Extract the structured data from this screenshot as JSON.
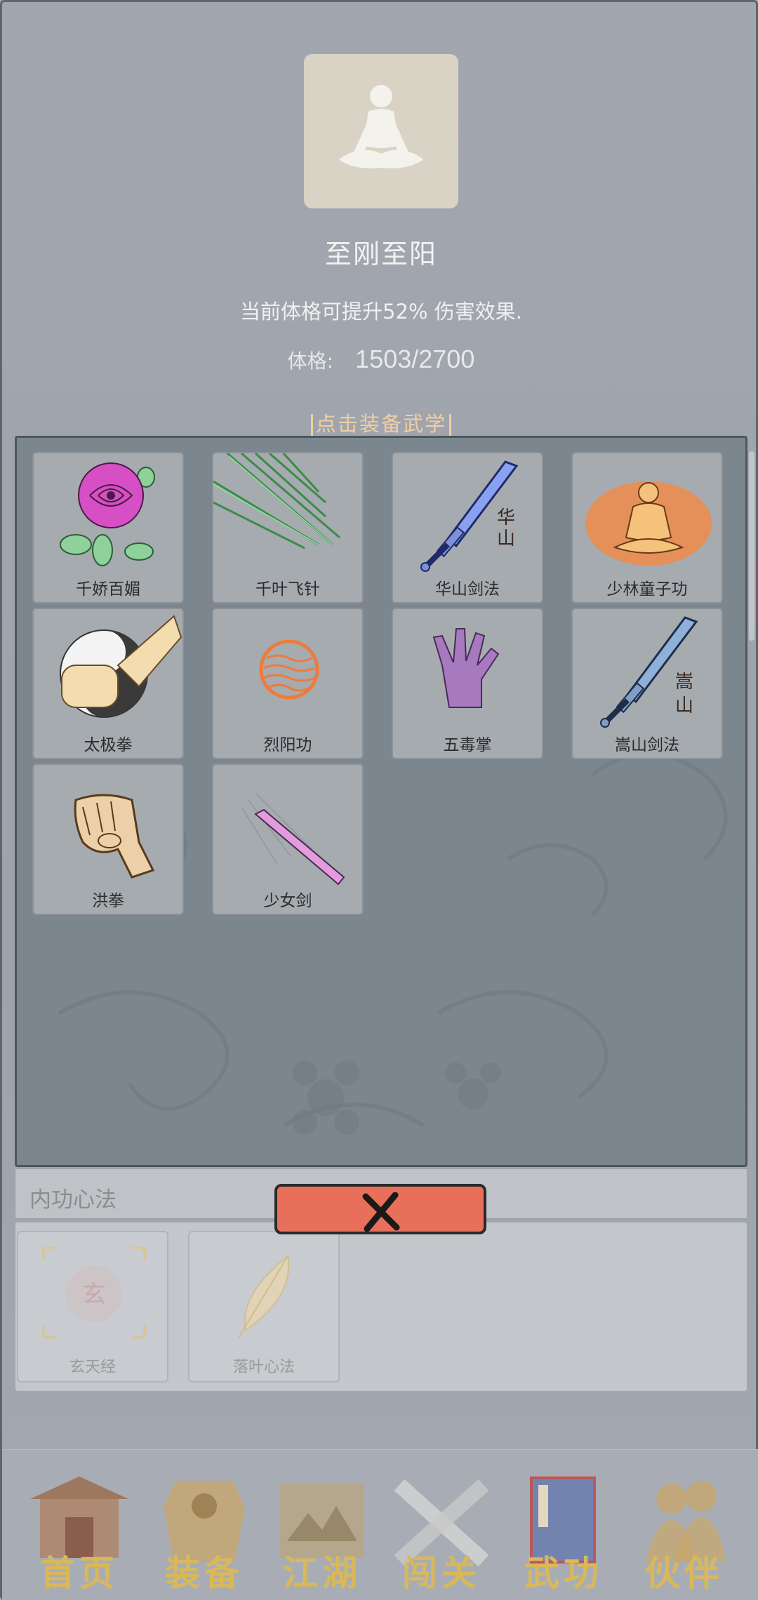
{
  "current_art": {
    "title": "至刚至阳",
    "description": "当前体格可提升52% 伤害效果.",
    "stat_label": "体格:",
    "stat_value": "1503/2700"
  },
  "hint": "点击装备武学",
  "martial_arts": [
    {
      "name": "千娇百媚",
      "icon": "rose-icon"
    },
    {
      "name": "千叶飞针",
      "icon": "needles-icon"
    },
    {
      "name": "华山剑法",
      "icon": "huashan-sword-icon",
      "glyph": "华山"
    },
    {
      "name": "少林童子功",
      "icon": "meditating-monk-icon"
    },
    {
      "name": "太极拳",
      "icon": "taiji-fist-icon"
    },
    {
      "name": "烈阳功",
      "icon": "sun-orb-icon"
    },
    {
      "name": "五毒掌",
      "icon": "purple-palm-icon"
    },
    {
      "name": "嵩山剑法",
      "icon": "songshan-sword-icon",
      "glyph": "嵩山"
    },
    {
      "name": "洪拳",
      "icon": "fist-icon"
    },
    {
      "name": "少女剑",
      "icon": "pink-sword-icon"
    }
  ],
  "inner_section": {
    "title": "内功心法",
    "items": [
      {
        "name": "玄天经",
        "icon": "xuan-seal-icon",
        "glyph": "玄"
      },
      {
        "name": "落叶心法",
        "icon": "leaf-icon"
      }
    ]
  },
  "close_button": {
    "icon": "close-x-icon"
  },
  "nav": [
    {
      "label": "首页",
      "icon": "temple-icon"
    },
    {
      "label": "装备",
      "icon": "armor-icon"
    },
    {
      "label": "江湖",
      "icon": "scroll-map-icon"
    },
    {
      "label": "闯关",
      "icon": "crossed-swords-icon"
    },
    {
      "label": "武功",
      "icon": "book-icon"
    },
    {
      "label": "伙伴",
      "icon": "companions-icon"
    }
  ],
  "colors": {
    "accent_gold": "#d9b85a",
    "hint_color": "#f0cfa2",
    "close_red": "#e8705a"
  }
}
